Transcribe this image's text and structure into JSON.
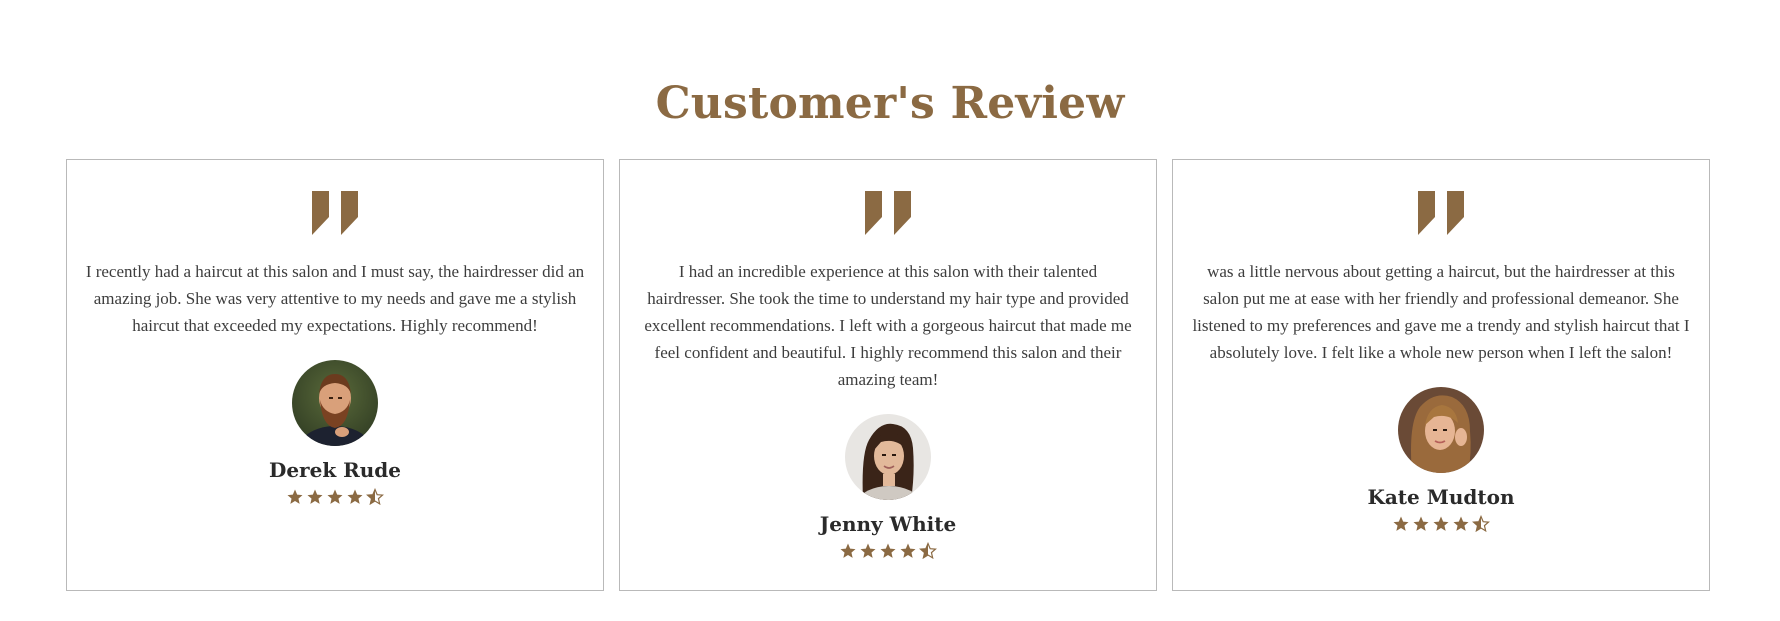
{
  "section": {
    "title": "Customer's Review"
  },
  "colors": {
    "accent": "#8b6a43",
    "border": "#b9b9b9",
    "text": "#3d3d3d",
    "name": "#2a2a2a"
  },
  "reviews": [
    {
      "text": "I recently had a haircut at this salon and I must say, the hairdresser did an amazing job. She was very attentive to my needs and gave me a stylish haircut that exceeded my expectations. Highly recommend!",
      "name": "Derek Rude",
      "rating": 4.5,
      "avatar": "bearded-man-photo"
    },
    {
      "text": "I had an incredible experience at this salon with their talented hairdresser. She took the time to understand my hair type and provided excellent recommendations. I left with a gorgeous haircut that made me feel confident and beautiful. I highly recommend this salon and their amazing team!",
      "name": "Jenny White",
      "rating": 4.5,
      "avatar": "brunette-woman-photo"
    },
    {
      "text": "was a little nervous about getting a haircut, but the hairdresser at this salon put me at ease with her friendly and professional demeanor. She listened to my preferences and gave me a trendy and stylish haircut that I absolutely love. I felt like a whole new person when I left the salon!",
      "name": "Kate Mudton",
      "rating": 4.5,
      "avatar": "blonde-woman-photo"
    }
  ]
}
